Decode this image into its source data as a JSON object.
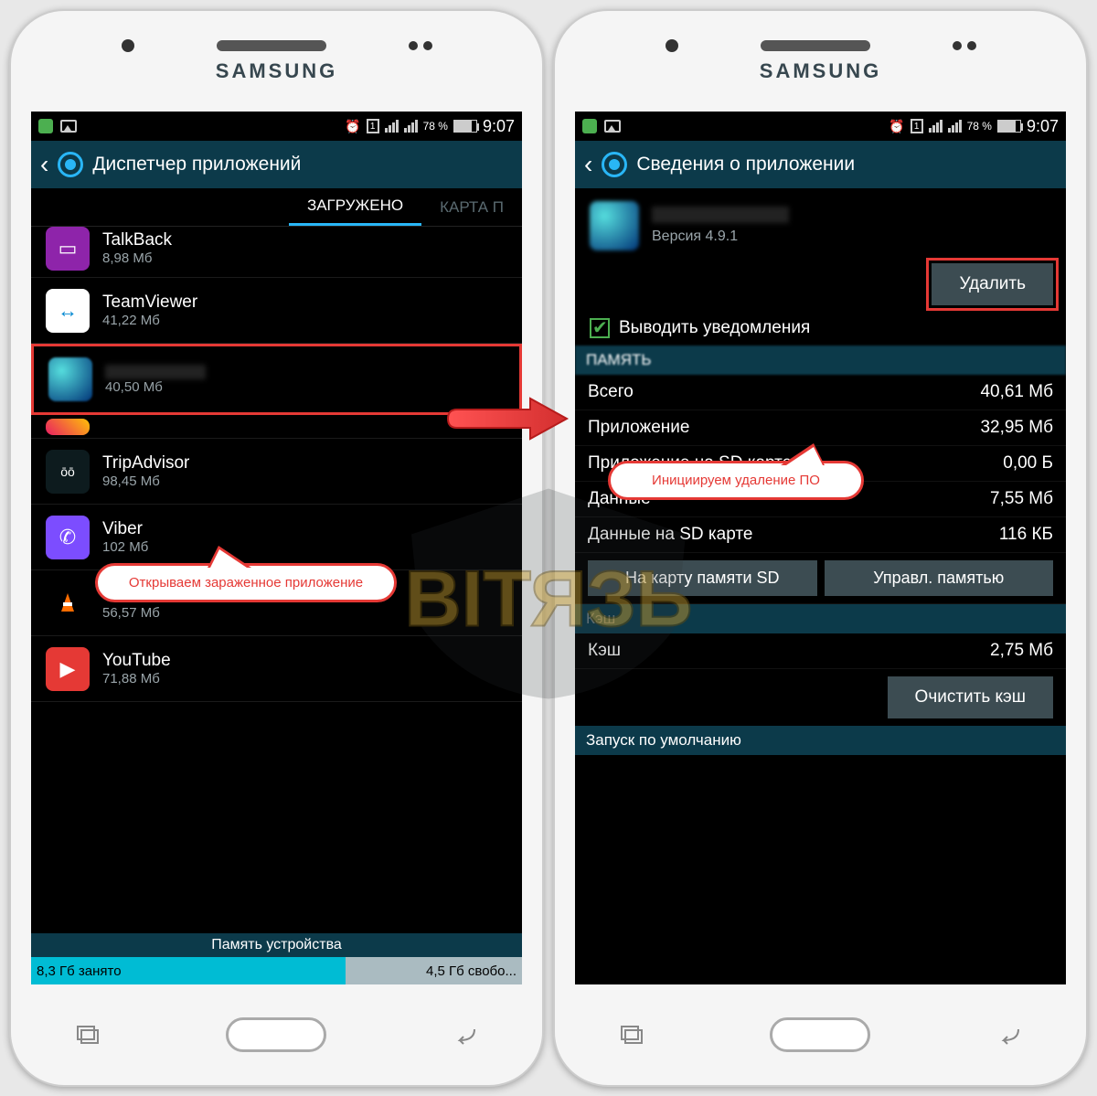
{
  "brand": "SAMSUNG",
  "status": {
    "sim_label": "1",
    "battery": "78 %",
    "time": "9:07"
  },
  "left": {
    "title": "Диспетчер приложений",
    "tabs": {
      "active": "ЗАГРУЖЕНО",
      "next": "КАРТА П"
    },
    "apps": [
      {
        "name": "TalkBack",
        "size": "8,98 Мб"
      },
      {
        "name": "TeamViewer",
        "size": "41,22 Мб"
      },
      {
        "name": "",
        "size": "40,50 Мб"
      },
      {
        "name": "TripAdvisor",
        "size": "98,45 Мб"
      },
      {
        "name": "Viber",
        "size": "102 Мб"
      },
      {
        "name": "VLC",
        "size": "56,57 Мб"
      },
      {
        "name": "YouTube",
        "size": "71,88 Мб"
      }
    ],
    "callout": "Открываем зараженное приложение",
    "storage": {
      "header": "Память устройства",
      "used": "8,3 Гб занято",
      "free": "4,5 Гб свобо..."
    }
  },
  "right": {
    "title": "Сведения о приложении",
    "version": "Версия 4.9.1",
    "delete_btn": "Удалить",
    "callout": "Инициируем удаление ПО",
    "notify_label": "Выводить уведомления",
    "sections": {
      "memory": "ПАМЯТЬ",
      "rows": [
        {
          "k": "Всего",
          "v": "40,61 Мб"
        },
        {
          "k": "Приложение",
          "v": "32,95 Мб"
        },
        {
          "k": "Приложение на SD карте",
          "v": "0,00 Б"
        },
        {
          "k": "Данные",
          "v": "7,55 Мб"
        },
        {
          "k": "Данные на SD карте",
          "v": "116 КБ"
        }
      ],
      "sd_btn": "На карту памяти SD",
      "mem_btn": "Управл. памятью",
      "cache_head": "Кэш",
      "cache_row": {
        "k": "Кэш",
        "v": "2,75 Мб"
      },
      "clear_cache": "Очистить кэш",
      "default_head": "Запуск по умолчанию"
    }
  },
  "watermark": "ВIТЯЗЬ"
}
